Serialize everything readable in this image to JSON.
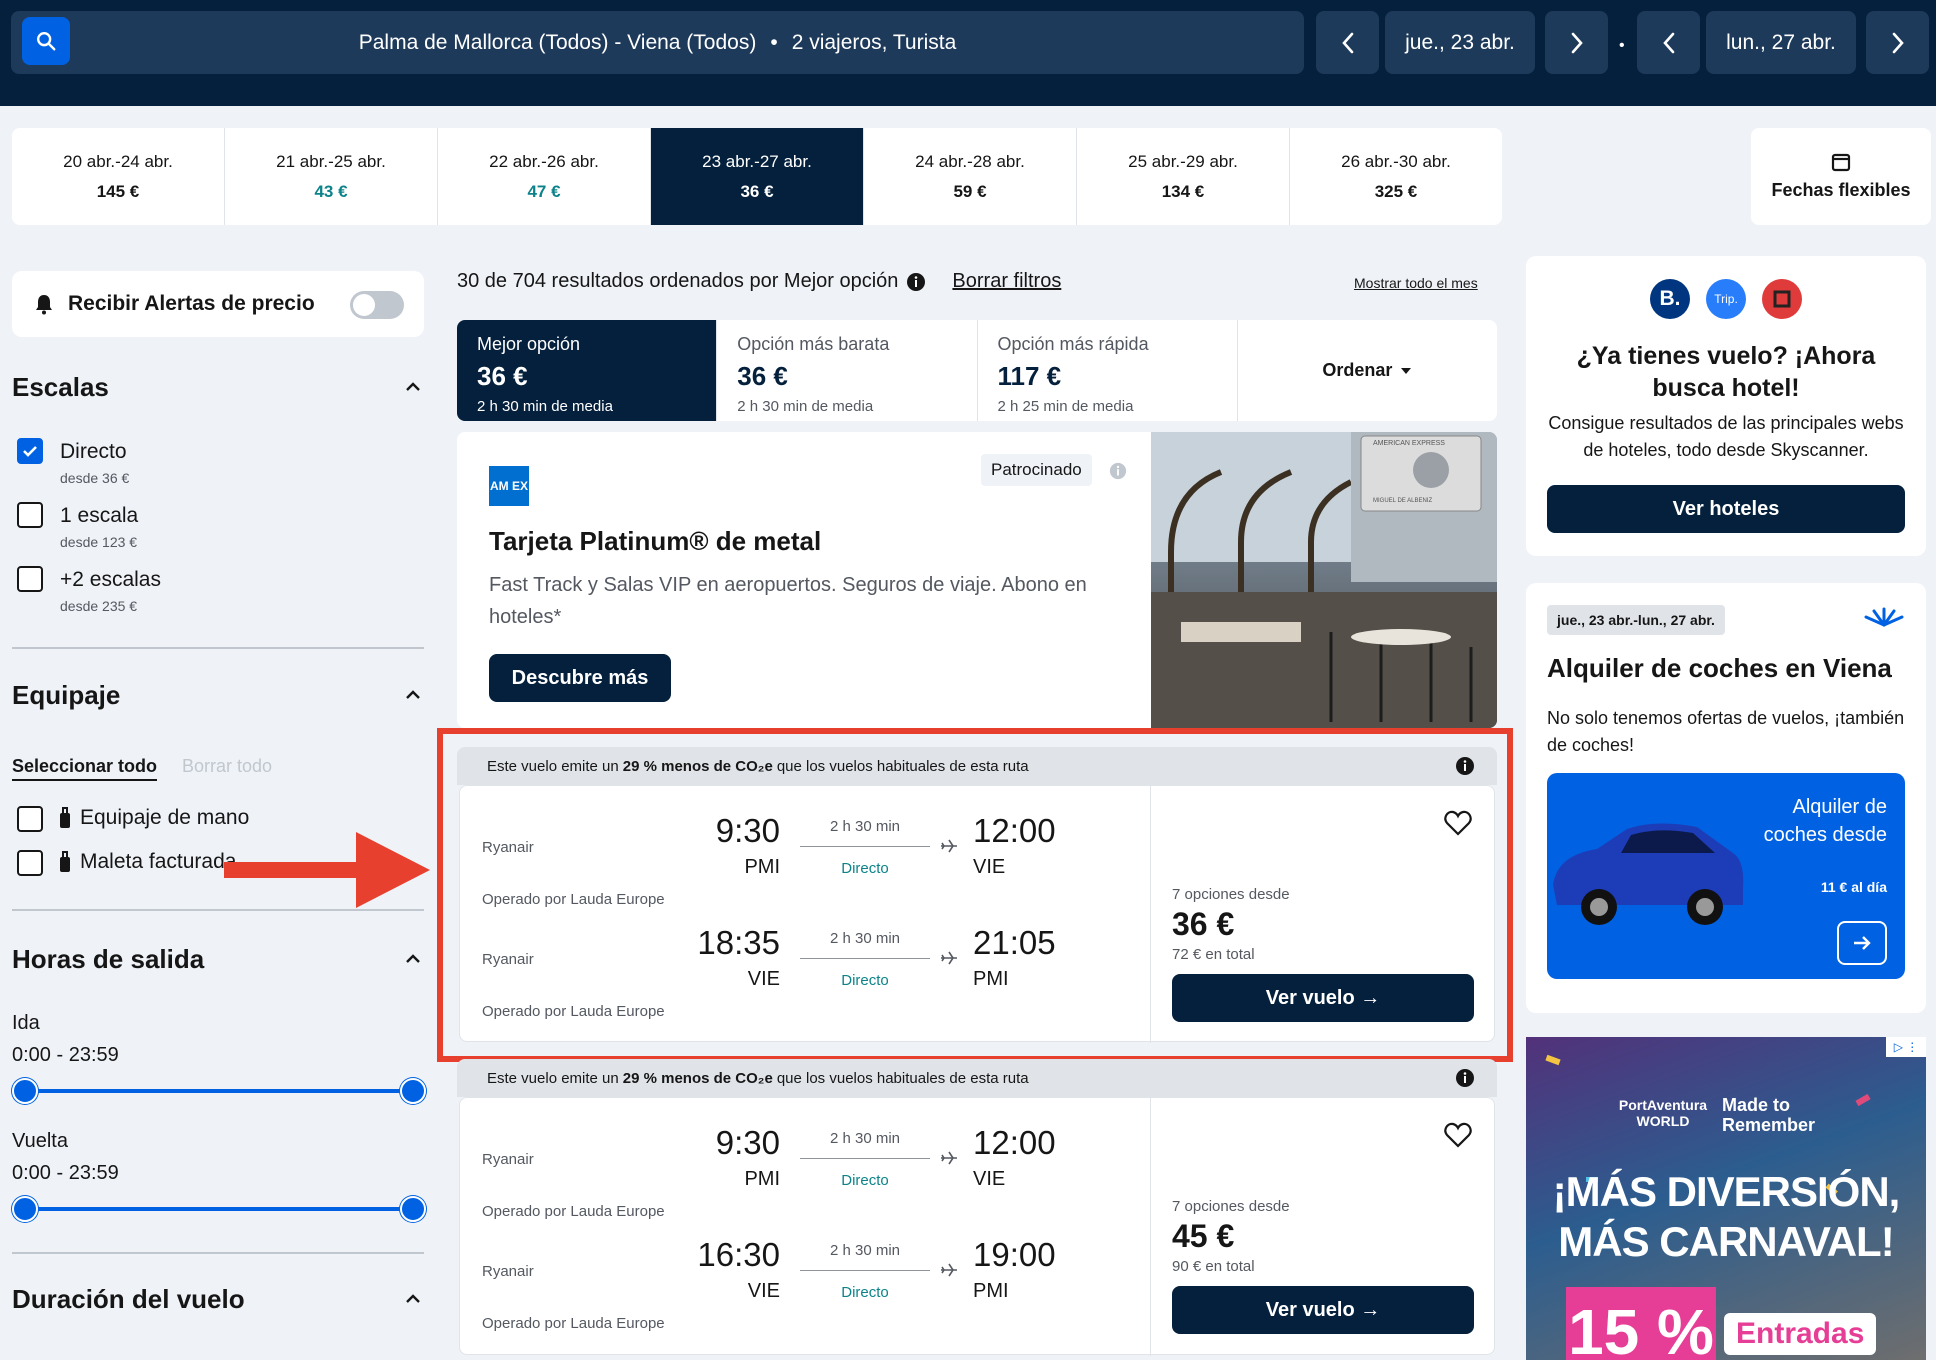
{
  "header": {
    "route": "Palma de Mallorca (Todos) - Viena (Todos)",
    "travelers": "2 viajeros, Turista",
    "separator": "•",
    "depart_date": "jue., 23 abr.",
    "return_date": "lun., 27 abr."
  },
  "date_strip": [
    {
      "range": "20 abr.-24 abr.",
      "price": "145 €"
    },
    {
      "range": "21 abr.-25 abr.",
      "price": "43 €"
    },
    {
      "range": "22 abr.-26 abr.",
      "price": "47 €"
    },
    {
      "range": "23 abr.-27 abr.",
      "price": "36 €"
    },
    {
      "range": "24 abr.-28 abr.",
      "price": "59 €"
    },
    {
      "range": "25 abr.-29 abr.",
      "price": "134 €"
    },
    {
      "range": "26 abr.-30 abr.",
      "price": "325 €"
    }
  ],
  "flexible_dates": "Fechas flexibles",
  "sidebar": {
    "price_alerts": "Recibir Alertas de precio",
    "stops": {
      "title": "Escalas",
      "options": [
        {
          "label": "Directo",
          "sub": "desde 36 €",
          "checked": true
        },
        {
          "label": "1 escala",
          "sub": "desde 123 €",
          "checked": false
        },
        {
          "label": "+2 escalas",
          "sub": "desde 235 €",
          "checked": false
        }
      ]
    },
    "baggage": {
      "title": "Equipaje",
      "select_all": "Seleccionar todo",
      "clear_all": "Borrar todo",
      "options": [
        "Equipaje de mano",
        "Maleta facturada"
      ]
    },
    "times": {
      "title": "Horas de salida",
      "outbound_label": "Ida",
      "outbound_range": "0:00 - 23:59",
      "return_label": "Vuelta",
      "return_range": "0:00 - 23:59"
    },
    "duration_title": "Duración del vuelo"
  },
  "results": {
    "summary": "30 de 704 resultados ordenados por Mejor opción",
    "clear_filters": "Borrar filtros",
    "show_month": "Mostrar todo el mes",
    "tabs": [
      {
        "label": "Mejor opción",
        "price": "36 €",
        "sub": "2 h 30 min de media"
      },
      {
        "label": "Opción más barata",
        "price": "36 €",
        "sub": "2 h 30 min de media"
      },
      {
        "label": "Opción más rápida",
        "price": "117 €",
        "sub": "2 h 25 min de media"
      }
    ],
    "sort_label": "Ordenar"
  },
  "ad": {
    "logo_text": "AM EX",
    "sponsored": "Patrocinado",
    "title": "Tarjeta Platinum® de metal",
    "body": "Fast Track y Salas VIP en aeropuertos. Seguros de viaje. Abono en hoteles*",
    "cta": "Descubre más",
    "card_brand": "AMERICAN EXPRESS",
    "card_name": "MIGUEL DE ALBENIZ"
  },
  "co2_pre": "Este vuelo emite un ",
  "co2_bold": "29 % menos de CO₂e",
  "co2_post": " que los vuelos habituales de esta ruta",
  "flights": [
    {
      "legs": [
        {
          "airline": "Ryanair",
          "operated": "Operado por Lauda Europe",
          "dep_time": "9:30",
          "dep_ap": "PMI",
          "duration": "2 h 30 min",
          "stops": "Directo",
          "arr_time": "12:00",
          "arr_ap": "VIE"
        },
        {
          "airline": "Ryanair",
          "operated": "Operado por Lauda Europe",
          "dep_time": "18:35",
          "dep_ap": "VIE",
          "duration": "2 h 30 min",
          "stops": "Directo",
          "arr_time": "21:05",
          "arr_ap": "PMI"
        }
      ],
      "options": "7 opciones desde",
      "price": "36 €",
      "total": "72 € en total",
      "cta": "Ver vuelo →"
    },
    {
      "legs": [
        {
          "airline": "Ryanair",
          "operated": "Operado por Lauda Europe",
          "dep_time": "9:30",
          "dep_ap": "PMI",
          "duration": "2 h 30 min",
          "stops": "Directo",
          "arr_time": "12:00",
          "arr_ap": "VIE"
        },
        {
          "airline": "Ryanair",
          "operated": "Operado por Lauda Europe",
          "dep_time": "16:30",
          "dep_ap": "VIE",
          "duration": "2 h 30 min",
          "stops": "Directo",
          "arr_time": "19:00",
          "arr_ap": "PMI"
        }
      ],
      "options": "7 opciones desde",
      "price": "45 €",
      "total": "90 € en total",
      "cta": "Ver vuelo →"
    }
  ],
  "hotels": {
    "partner1": "B.",
    "partner2": "Trip.",
    "title": "¿Ya tienes vuelo? ¡Ahora busca hotel!",
    "body": "Consigue resultados de las principales webs de hoteles, todo desde Skyscanner.",
    "cta": "Ver hoteles"
  },
  "cars": {
    "dates": "jue., 23 abr.-lun., 27 abr.",
    "title": "Alquiler de coches en Viena",
    "body": "No solo tenemos ofertas de vuelos, ¡también de coches!",
    "promo_line": "Alquiler de coches desde",
    "promo_price": "11 € al día"
  },
  "banner": {
    "brand": "PortAventura WORLD",
    "tagline": "Made to Remember",
    "headline1": "¡MÁS DIVERSIÓN,",
    "headline2": "MÁS CARNAVAL!",
    "discount": "15 %",
    "sub": "Entradas"
  },
  "colors": {
    "navy": "#05203c",
    "blue": "#0062e3",
    "teal": "#0c838a",
    "highlight": "#e8402f"
  }
}
